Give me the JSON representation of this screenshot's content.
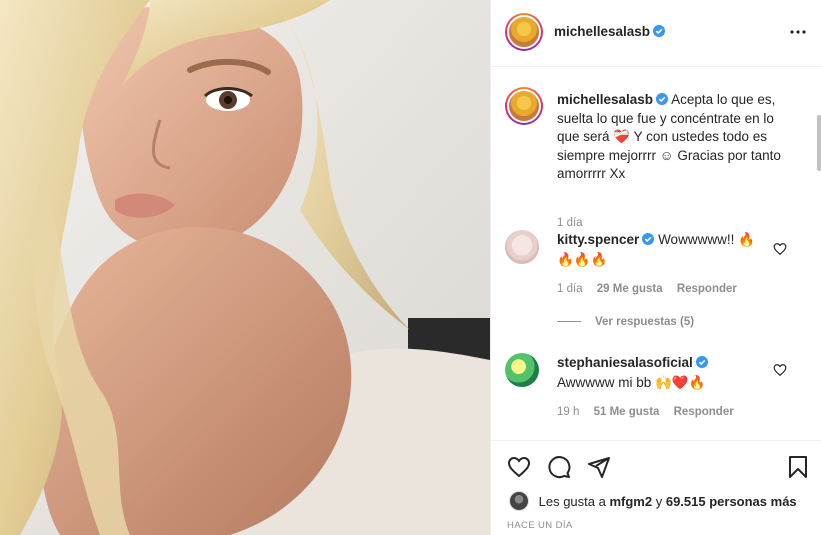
{
  "post": {
    "username": "michellesalasb",
    "verified": true
  },
  "caption": {
    "username": "michellesalasb",
    "text_part1": "Acepta lo que es, suelta lo que fue y concéntrate en lo que será",
    "emoji1": "❤️‍🩹",
    "text_part2": "Y con ustedes todo es siempre mejorrrr",
    "emoji2": "☺",
    "text_part3": "Gracias por tanto amorrrrr Xx",
    "time": "1 día"
  },
  "comments": [
    {
      "username": "kitty.spencer",
      "text": "Wowwwww!!",
      "emojis": "🔥\n🔥🔥🔥",
      "time": "1 día",
      "likes": "29 Me gusta",
      "reply": "Responder"
    },
    {
      "username": "stephaniesalasoficial",
      "text": "Awwwww mi bb",
      "emojis": "🙌❤️🔥",
      "time": "19 h",
      "likes": "51 Me gusta",
      "reply": "Responder"
    }
  ],
  "view_replies": "Ver respuestas (5)",
  "likes": {
    "prefix": "Les gusta a",
    "user": "mfgm2",
    "joiner": "y",
    "others": "69.515 personas más"
  },
  "timestamp": "HACE UN DÍA",
  "icons": [
    "more-icon",
    "verified-icon",
    "heart-icon",
    "comment-icon",
    "share-icon",
    "bookmark-icon"
  ],
  "colors": {
    "verified": "#3897f0",
    "meta": "#8e8e8e",
    "text": "#262626",
    "heart_red": "#ed4956"
  }
}
